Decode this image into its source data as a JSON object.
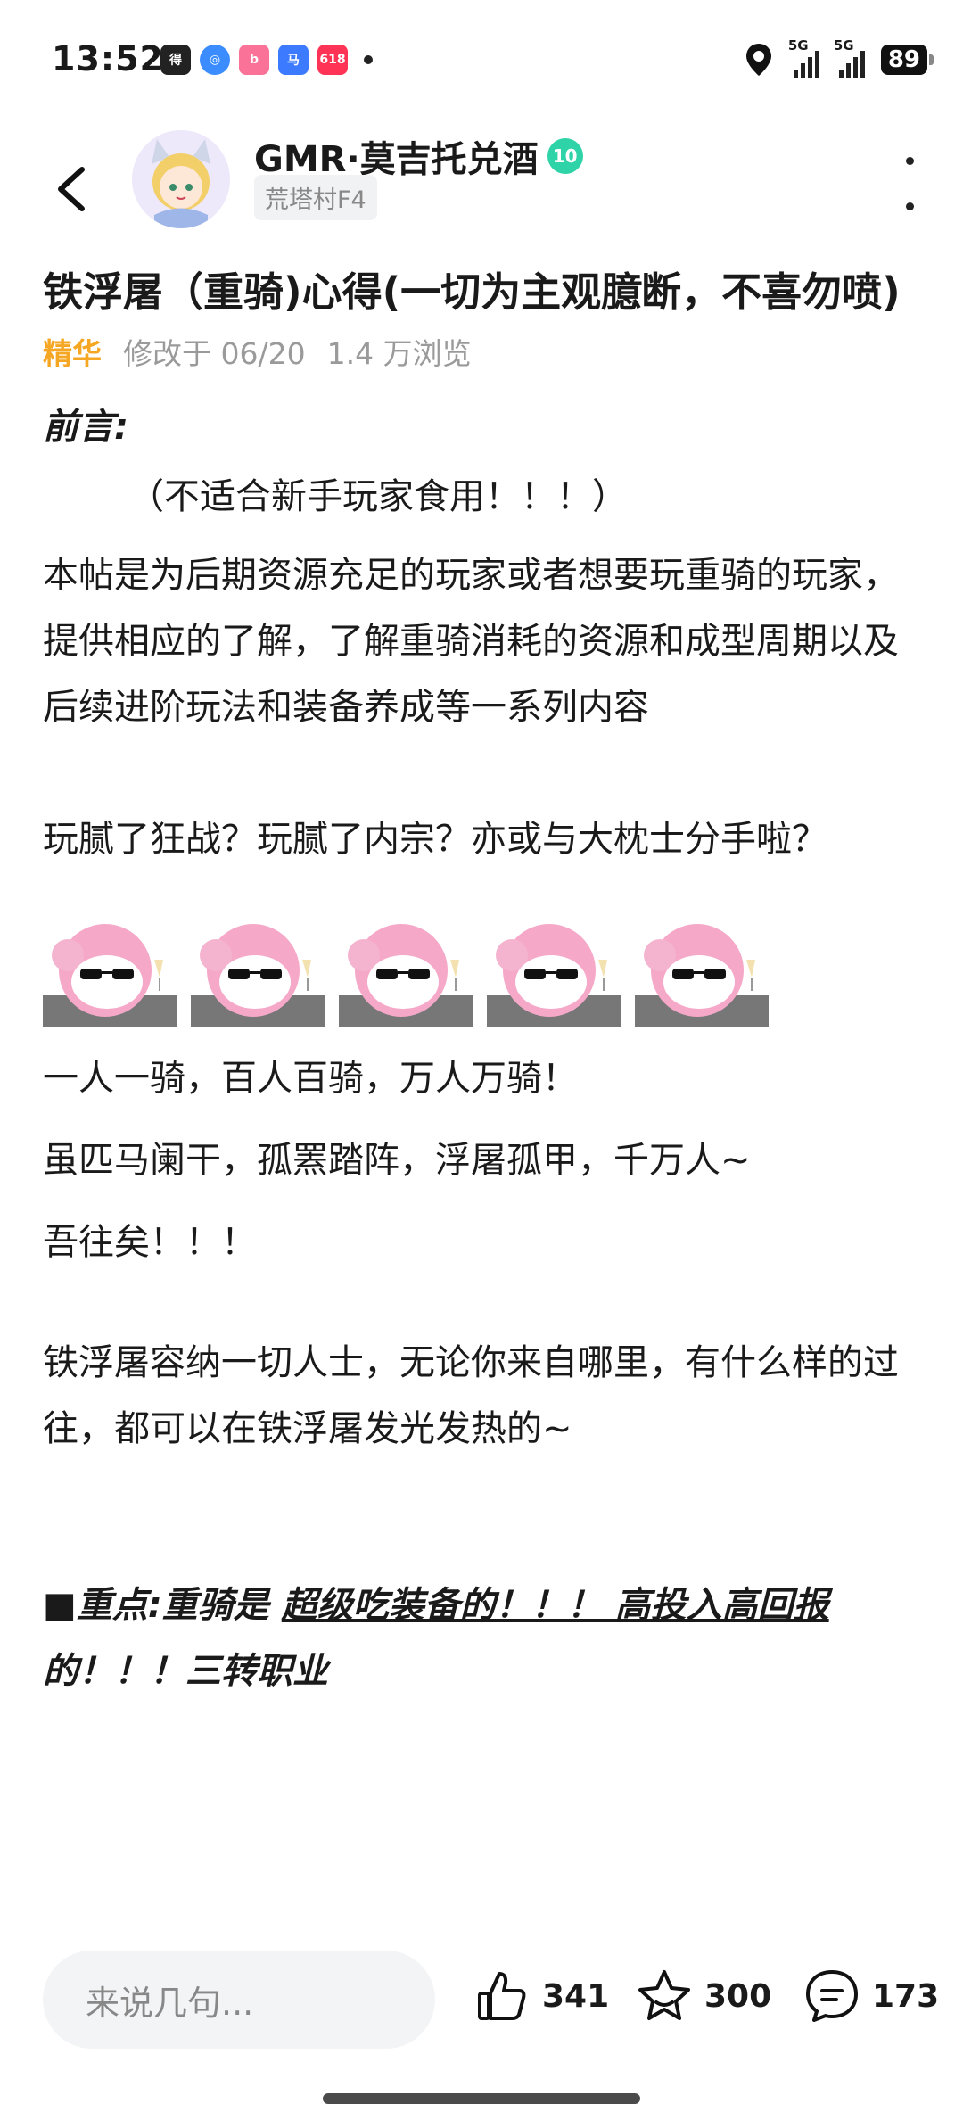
{
  "status_bar": {
    "time": "13:52",
    "app_icons": [
      "得物",
      "夸克",
      "bilibili",
      "马克",
      "618"
    ],
    "signal1": "5G",
    "signal2": "5G",
    "battery": "89"
  },
  "header": {
    "author": "GMR·莫吉托兑酒",
    "level": "10",
    "location": "荒塔村F4"
  },
  "post": {
    "title": "铁浮屠（重骑)心得(一切为主观臆断，不喜勿喷)",
    "essence": "精华",
    "modified": "修改于 06/20",
    "views": "1.4 万浏览",
    "intro_heading": "前言:",
    "warning": "（不适合新手玩家食用！！！）",
    "para1": " 本帖是为后期资源充足的玩家或者想要玩重骑的玩家，提供相应的了解，了解重骑消耗的资源和成型周期以及后续进阶玩法和装备养成等一系列内容",
    "para2": "玩腻了狂战？玩腻了内宗？亦或与大枕士分手啦？",
    "line1": "一人一骑，百人百骑，万人万骑！",
    "line2": "虽匹马阑干，孤罴踏阵，浮屠孤甲，千万人~",
    "line3": "吾往矣！！！",
    "para3": "铁浮屠容纳一切人士，无论你来自哪里，有什么样的过往，都可以在铁浮屠发光发热的~",
    "key_prefix": "■重点:重骑是 ",
    "key_underlined": "超级吃装备的！！！ 高投入高回报",
    "key_cut": "的！！！三转职业"
  },
  "bottom_bar": {
    "comment_placeholder": "来说几句...",
    "likes": "341",
    "favorites": "300",
    "comments": "173"
  }
}
